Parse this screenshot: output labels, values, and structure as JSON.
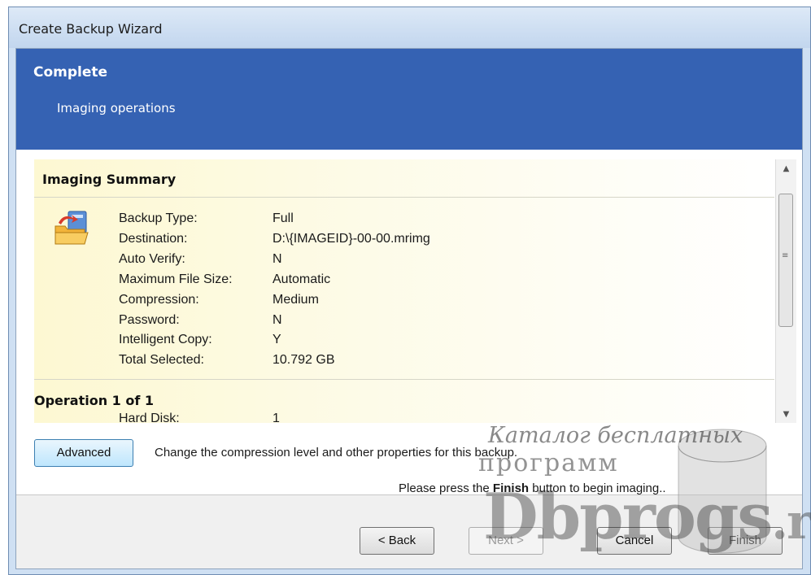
{
  "window": {
    "title": "Create Backup Wizard"
  },
  "banner": {
    "title": "Complete",
    "subtitle": "Imaging operations"
  },
  "summary": {
    "heading": "Imaging Summary",
    "rows": [
      {
        "label": "Backup Type:",
        "value": "Full"
      },
      {
        "label": "Destination:",
        "value": "D:\\{IMAGEID}-00-00.mrimg"
      },
      {
        "label": "Auto Verify:",
        "value": "N"
      },
      {
        "label": "Maximum File Size:",
        "value": "Automatic"
      },
      {
        "label": "Compression:",
        "value": "Medium"
      },
      {
        "label": "Password:",
        "value": "N"
      },
      {
        "label": "Intelligent Copy:",
        "value": "Y"
      },
      {
        "label": "Total Selected:",
        "value": "10.792 GB"
      }
    ],
    "operation_heading": "Operation 1 of 1",
    "operation_rows": [
      {
        "label": "Hard Disk:",
        "value": "1"
      }
    ]
  },
  "advanced": {
    "button_label": "Advanced",
    "description": "Change the compression level and other properties for this backup."
  },
  "instruction": {
    "before": "Please press the ",
    "bold": "Finish",
    "after": " button to begin imaging.."
  },
  "buttons": {
    "back": "< Back",
    "next": "Next >",
    "cancel": "Cancel",
    "finish": "Finish"
  },
  "watermark": {
    "line1": "Каталог бесплатных",
    "line2": "программ",
    "brand": "Dbprogs",
    "tld": ".ru"
  },
  "colors": {
    "banner": "#3562b3",
    "panel": "#fdf8d2"
  },
  "icons": {
    "summary": "backup-folder-icon"
  }
}
